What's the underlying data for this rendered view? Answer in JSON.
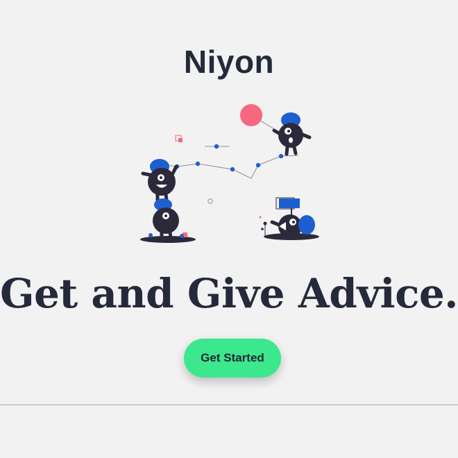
{
  "header": {
    "brand": "Niyon"
  },
  "hero": {
    "headline": "Get and Give Advice.",
    "illustration_icon": "monsters-climbing-network-illustration"
  },
  "cta": {
    "label": "Get Started"
  },
  "colors": {
    "background": "#f2f2f3",
    "text": "#252a3b",
    "accent_green": "#3ce88e",
    "accent_blue": "#1d5fd0",
    "accent_pink": "#f7677f",
    "monster_dark": "#2c2a3a",
    "divider": "#a9a9bd"
  }
}
